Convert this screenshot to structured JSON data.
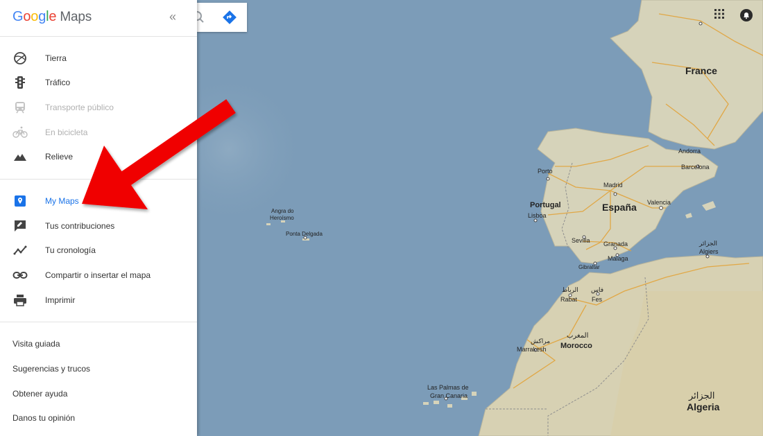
{
  "app": {
    "logo_google": [
      "G",
      "o",
      "o",
      "g",
      "l",
      "e"
    ],
    "logo_maps": "Maps",
    "collapse_glyph": "«"
  },
  "menu_layers": [
    {
      "label": "Tierra",
      "icon": "earth-icon"
    },
    {
      "label": "Tráfico",
      "icon": "traffic-icon"
    },
    {
      "label": "Transporte público",
      "icon": "transit-icon"
    },
    {
      "label": "En bicicleta",
      "icon": "bicycle-icon"
    },
    {
      "label": "Relieve",
      "icon": "terrain-icon"
    }
  ],
  "menu_personal": [
    {
      "label": "My Maps",
      "icon": "my-maps-icon"
    },
    {
      "label": "Tus contribuciones",
      "icon": "contributions-icon"
    },
    {
      "label": "Tu cronología",
      "icon": "timeline-icon"
    },
    {
      "label": "Compartir o insertar el mapa",
      "icon": "link-icon"
    },
    {
      "label": "Imprimir",
      "icon": "print-icon"
    }
  ],
  "menu_help": [
    "Visita guiada",
    "Sugerencias y trucos",
    "Obtener ayuda",
    "Danos tu opinión"
  ],
  "map_labels": {
    "france": "France",
    "andorra": "Andorra",
    "barcelona": "Barcelona",
    "porto": "Porto",
    "madrid": "Madrid",
    "espana": "España",
    "valencia": "Valencia",
    "portugal": "Portugal",
    "lisboa": "Lisboa",
    "sevilla": "Sevilla",
    "granada": "Granada",
    "malaga": "Malaga",
    "gibraltar": "Gibraltar",
    "angra_1": "Angra do",
    "angra_2": "Heroísmo",
    "ponta": "Ponta Delgada",
    "rabat_ar": "الرباط",
    "rabat": "Rabat",
    "fes_ar": "فاس",
    "fes": "Fes",
    "algiers_ar": "الجزائر",
    "algiers": "Algiers",
    "morocco_ar": "المغرب",
    "morocco": "Morocco",
    "marrakesh_ar": "مراكش",
    "marrakesh": "Marrakesh",
    "laspalmas_1": "Las Palmas de",
    "laspalmas_2": "Gran Canaria",
    "algeria_ar": "الجزائر",
    "algeria": "Algeria"
  },
  "colors": {
    "sea": "#7f9fba",
    "land": "#d5d3b9",
    "roads": "#e2a33a",
    "accent": "#1a73e8",
    "arrow": "#f00000"
  }
}
